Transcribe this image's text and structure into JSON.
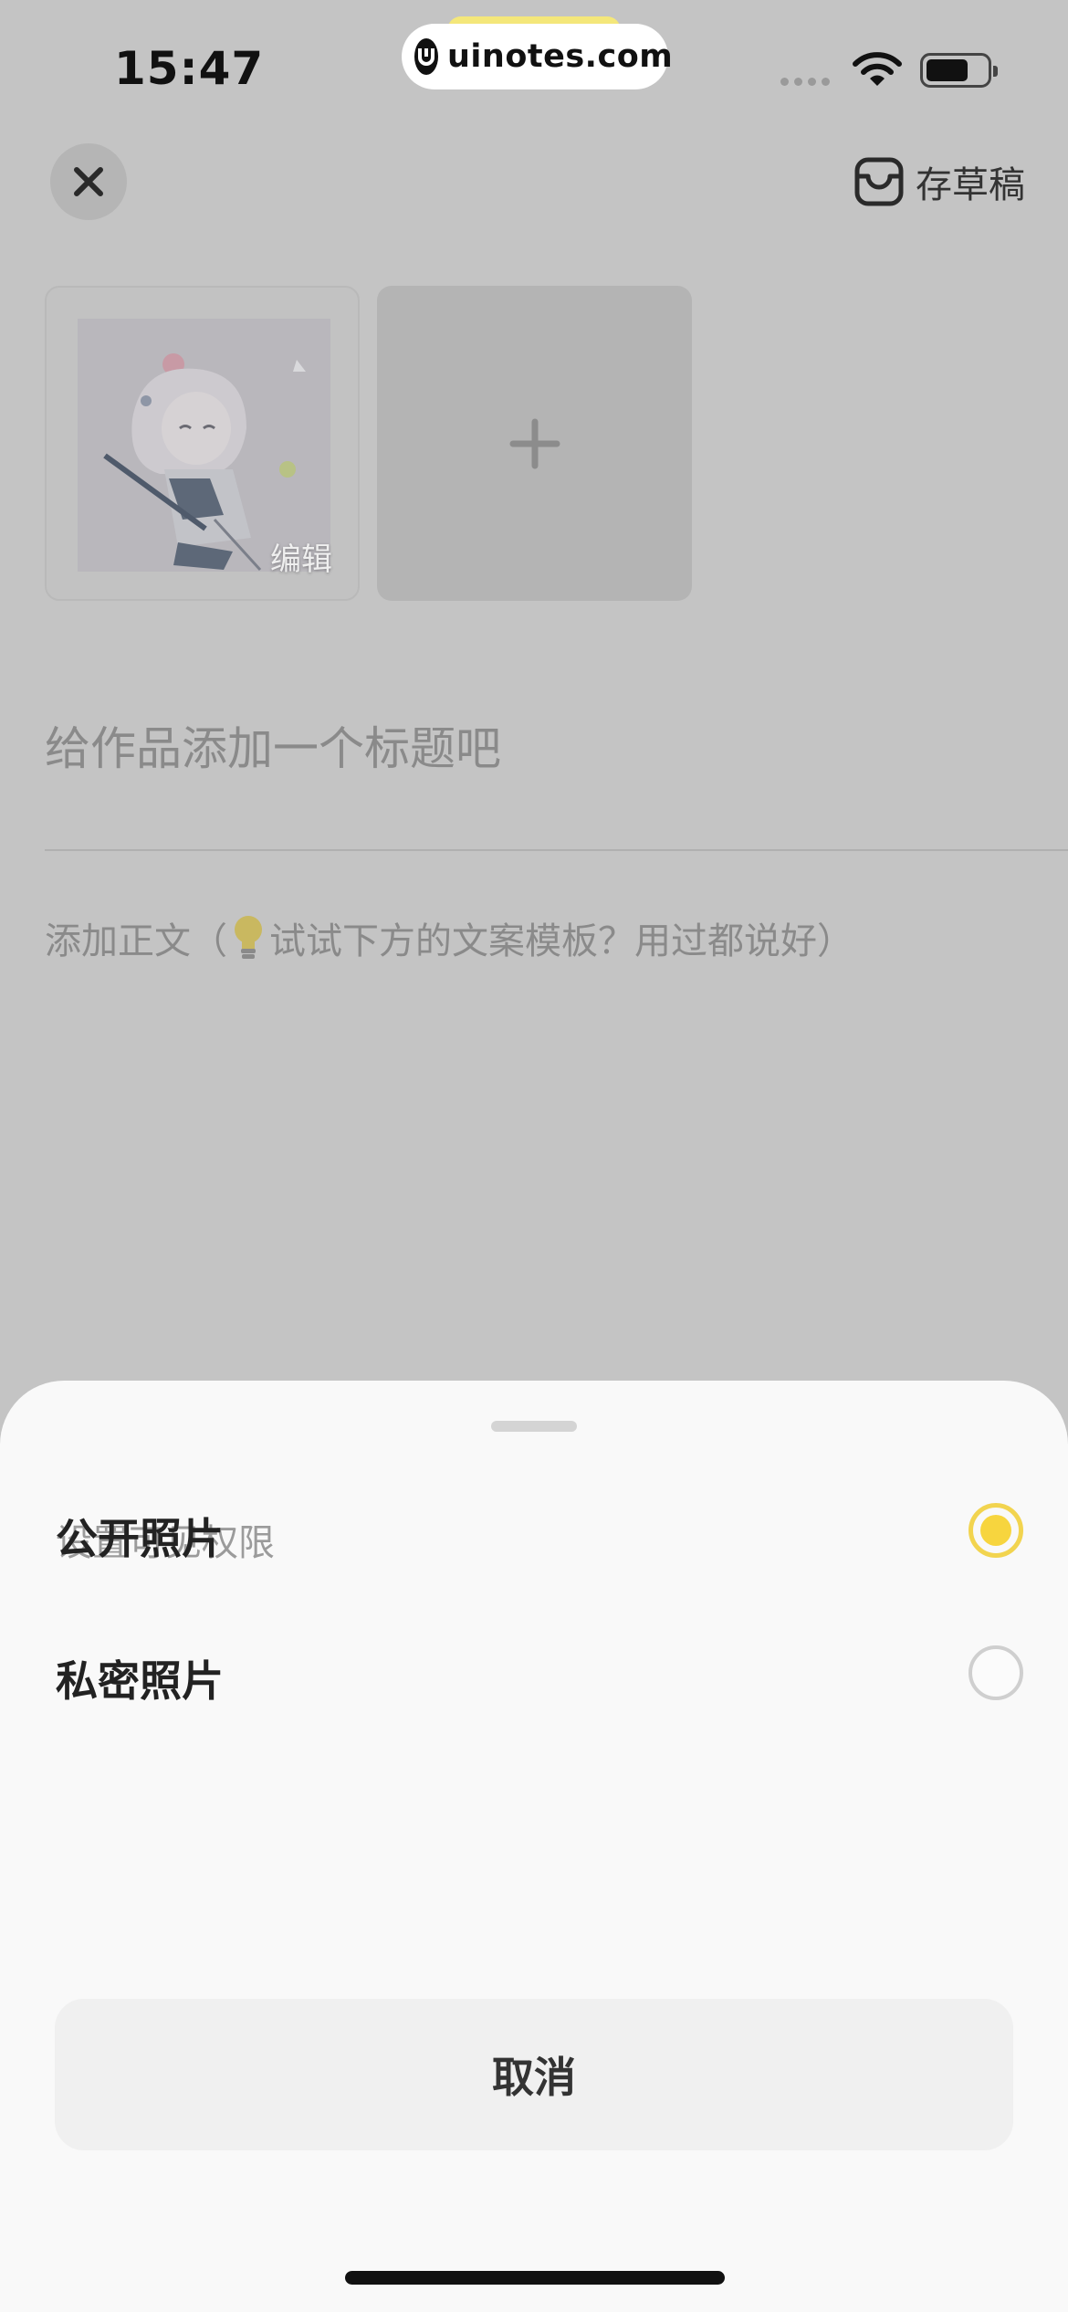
{
  "status_bar": {
    "time": "15:47",
    "watermark": "uinotes.com"
  },
  "header": {
    "close_icon": "close-icon",
    "draft_icon": "inbox-icon",
    "draft_label": "存草稿"
  },
  "media": {
    "edit_label": "编辑",
    "add_icon": "plus-icon"
  },
  "title_input": {
    "placeholder": "给作品添加一个标题吧",
    "value": ""
  },
  "body_input": {
    "placeholder_prefix": "添加正文（",
    "placeholder_icon": "lightbulb-icon",
    "placeholder_suffix": "试试下方的文案模板？用过都说好）"
  },
  "visibility_sheet": {
    "title": "设置可见权限",
    "options": [
      {
        "label": "公开照片",
        "selected": true
      },
      {
        "label": "私密照片",
        "selected": false
      }
    ],
    "cancel_label": "取消"
  },
  "colors": {
    "accent": "#f7d53e",
    "overlay": "#c4c4c4",
    "sheet_bg": "#f9f9f9"
  }
}
